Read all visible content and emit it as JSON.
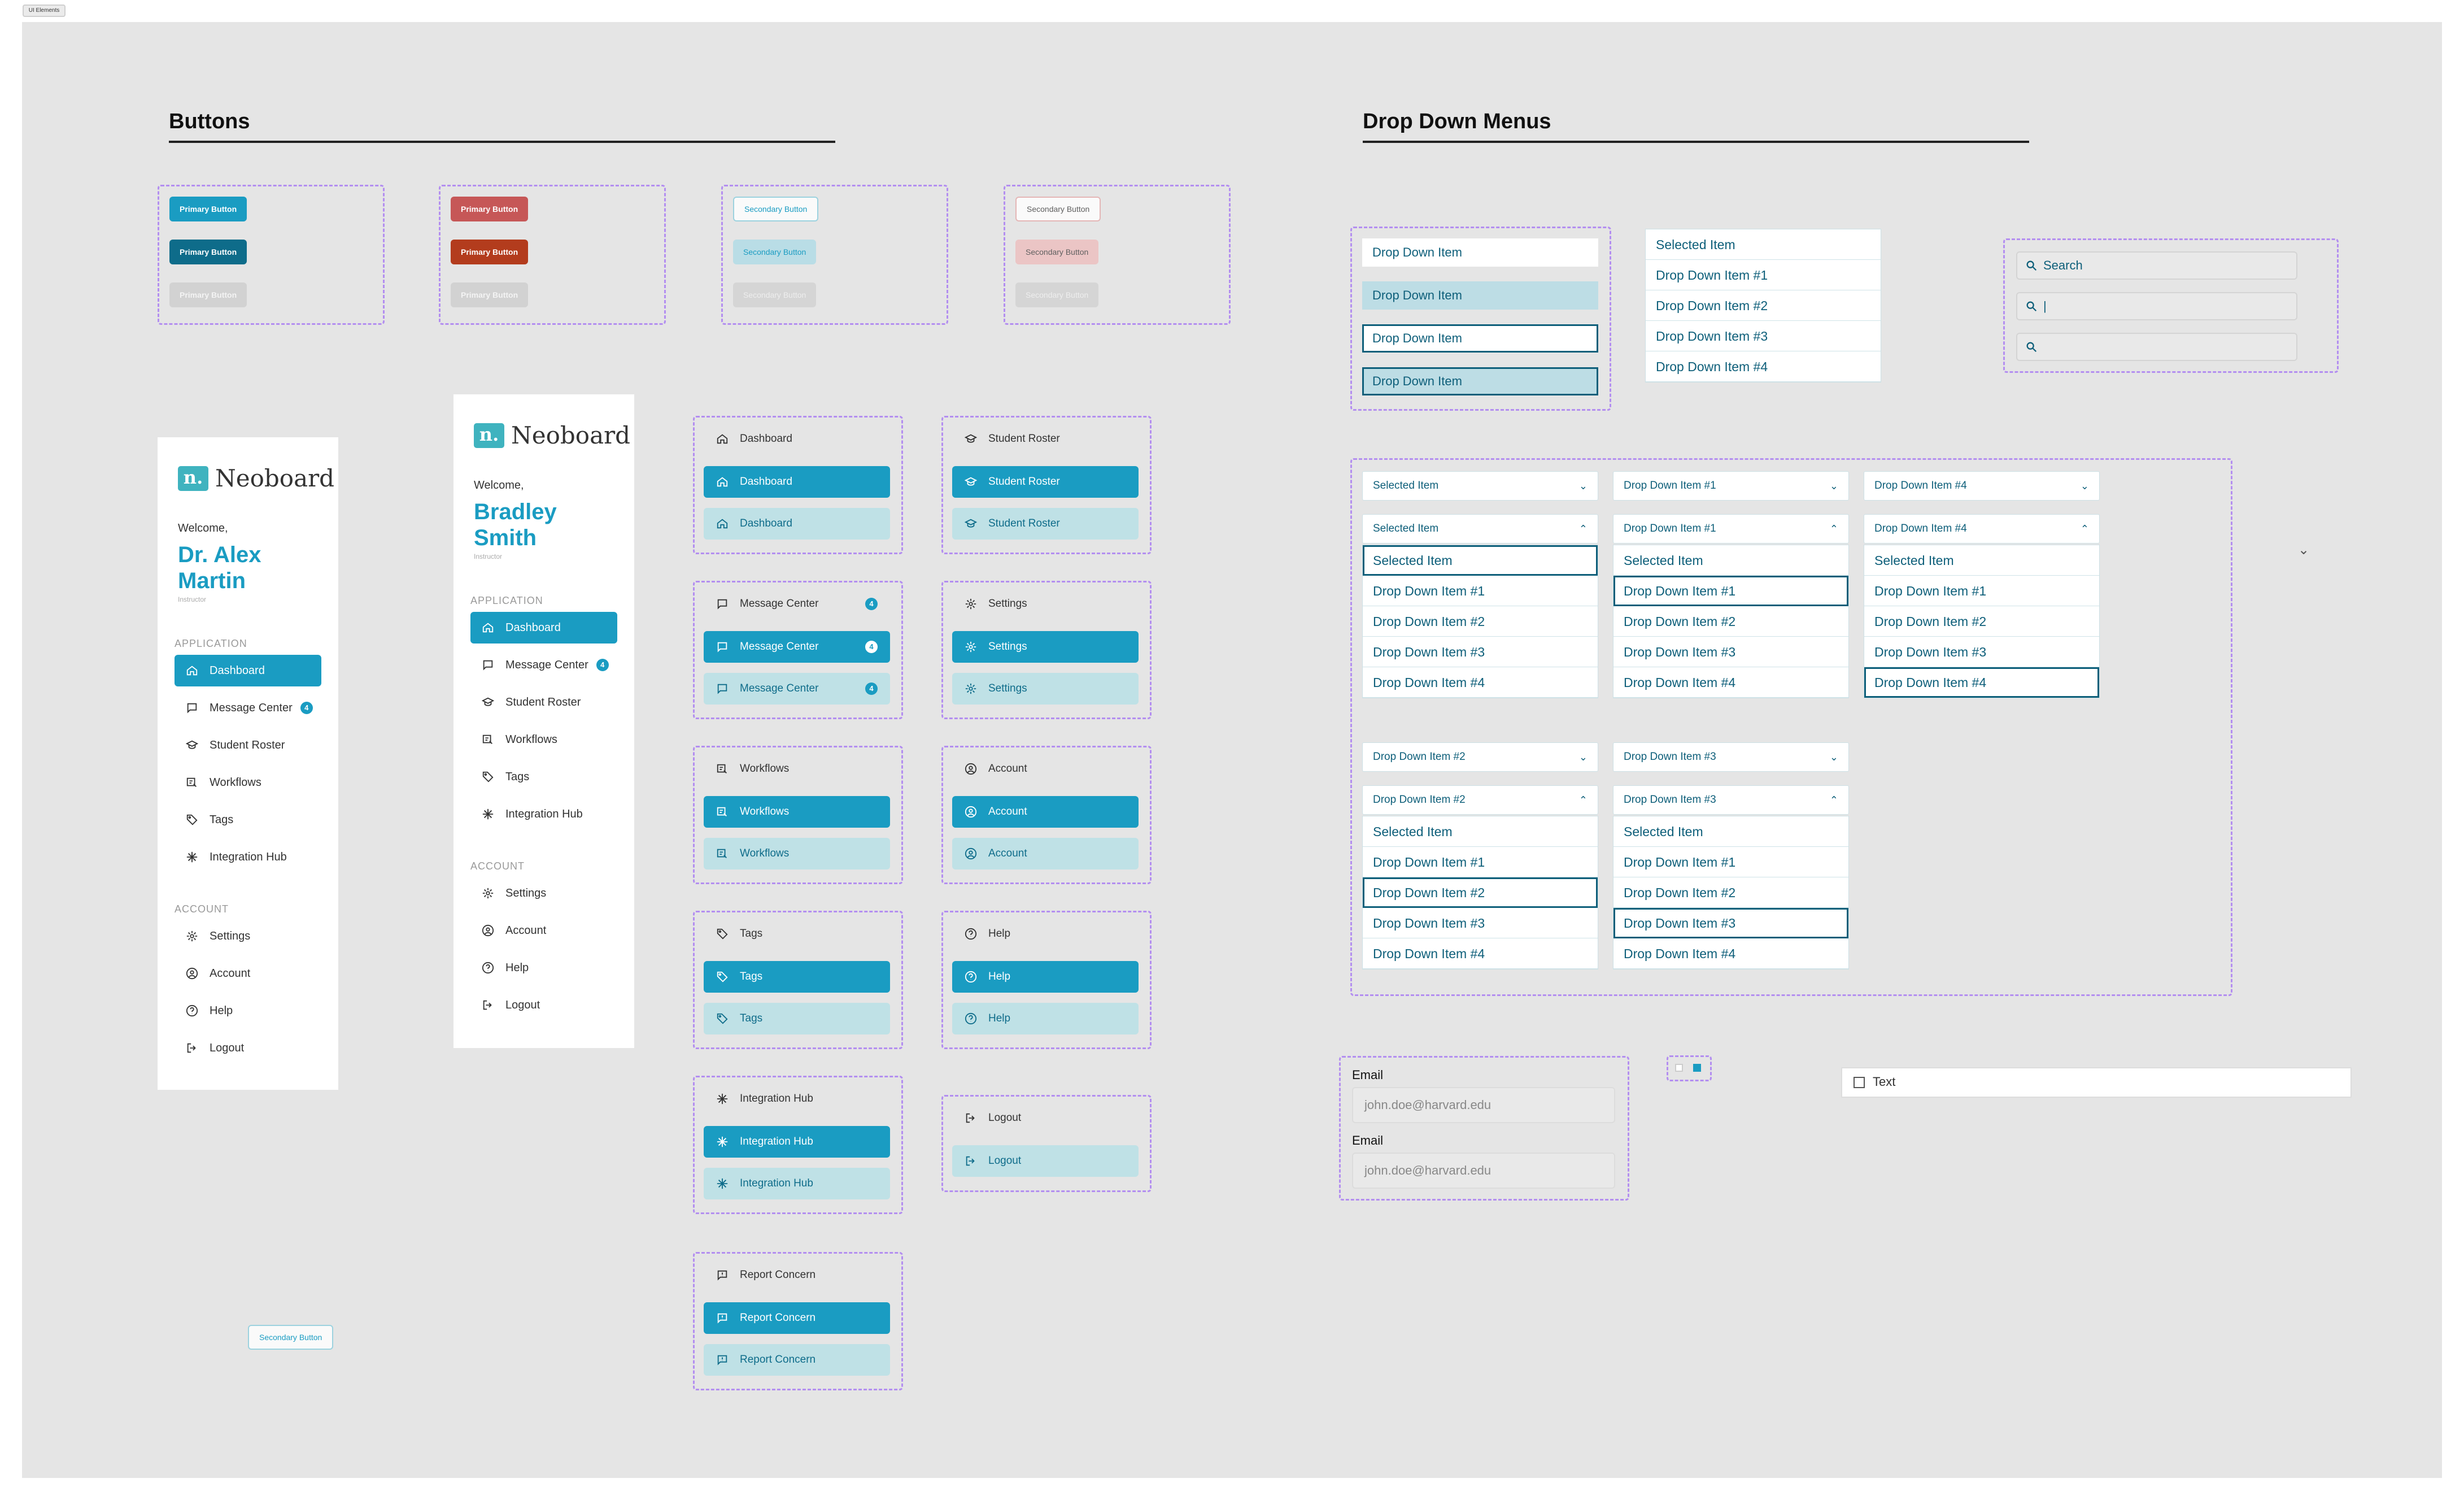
{
  "frame_label": "UI Elements",
  "headings": {
    "buttons": "Buttons",
    "dropdowns": "Drop Down Menus"
  },
  "buttons": {
    "primary": "Primary Button",
    "secondary": "Secondary Button"
  },
  "brand": {
    "mark": "n.",
    "name": "Neoboard"
  },
  "sidebar1": {
    "welcome": "Welcome,",
    "name_line1": "Dr. Alex",
    "name_line2": "Martin",
    "role": "Instructor"
  },
  "sidebar2": {
    "welcome": "Welcome,",
    "name_line1": "Bradley",
    "name_line2": "Smith",
    "role": "Instructor"
  },
  "sections": {
    "application": "APPLICATION",
    "account": "ACCOUNT"
  },
  "nav": {
    "dashboard": "Dashboard",
    "message_center": "Message Center",
    "student_roster": "Student Roster",
    "workflows": "Workflows",
    "tags": "Tags",
    "integration_hub": "Integration Hub",
    "settings": "Settings",
    "account": "Account",
    "help": "Help",
    "logout": "Logout",
    "report_concern": "Report Concern"
  },
  "badge_count": "4",
  "dropdown": {
    "item": "Drop Down Item",
    "selected": "Selected Item",
    "i1": "Drop Down Item #1",
    "i2": "Drop Down Item #2",
    "i3": "Drop Down Item #3",
    "i4": "Drop Down Item #4"
  },
  "search": {
    "placeholder": "Search",
    "typing": "|"
  },
  "email": {
    "label": "Email",
    "value": "john.doe@harvard.edu"
  },
  "checkbox_text": "Text",
  "colors": {
    "primary": "#1a9cc2",
    "primary_dark": "#0e6c8a",
    "danger": "#c65757",
    "danger_dark": "#b33c1d",
    "hover": "#bfe1e6"
  }
}
